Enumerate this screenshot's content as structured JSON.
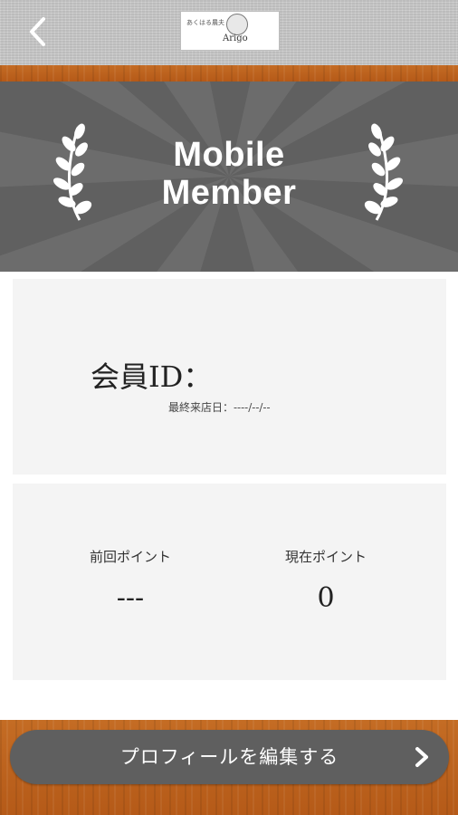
{
  "header": {
    "back_icon": "chevron-left-icon",
    "logo_tagline": "あくはる農夫",
    "logo_name": "Arigo"
  },
  "banner": {
    "title_line1": "Mobile",
    "title_line2": "Member",
    "decor_icon": "laurel-icon"
  },
  "member": {
    "id_label": "会員ID：",
    "last_visit": "最終来店日：----/--/--"
  },
  "points": {
    "previous_label": "前回ポイント",
    "previous_value": "---",
    "current_label": "現在ポイント",
    "current_value": "0"
  },
  "footer": {
    "edit_profile_label": "プロフィールを編集する",
    "chevron_icon": "chevron-right-icon"
  },
  "colors": {
    "header_bg": "#c9c9c9",
    "banner_bg": "#606060",
    "wood": "#b85f1c",
    "card_bg": "#f4f4f4",
    "button_bg": "#5f5f5f"
  }
}
